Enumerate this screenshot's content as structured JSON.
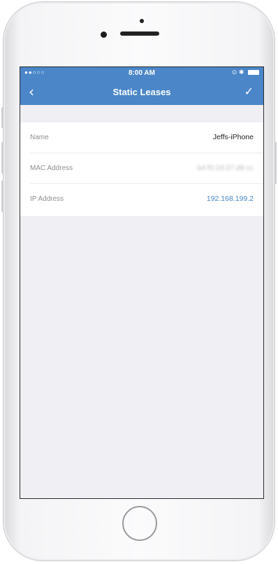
{
  "status_bar": {
    "signal": "●●○○○",
    "time": "8:00 AM",
    "icons": "⊙ ✱"
  },
  "nav": {
    "back_icon": "‹",
    "title": "Static Leases",
    "confirm_icon": "✓"
  },
  "fields": [
    {
      "label": "Name",
      "value": "Jeffs-iPhone"
    },
    {
      "label": "MAC Address",
      "value": "b4:f0:2d:37:d8:cc"
    },
    {
      "label": "IP Address",
      "value": "192.168.199.2"
    }
  ],
  "colors": {
    "nav_background": "#4a86c8",
    "link": "#4a86c8",
    "screen_background": "#efeff4"
  }
}
